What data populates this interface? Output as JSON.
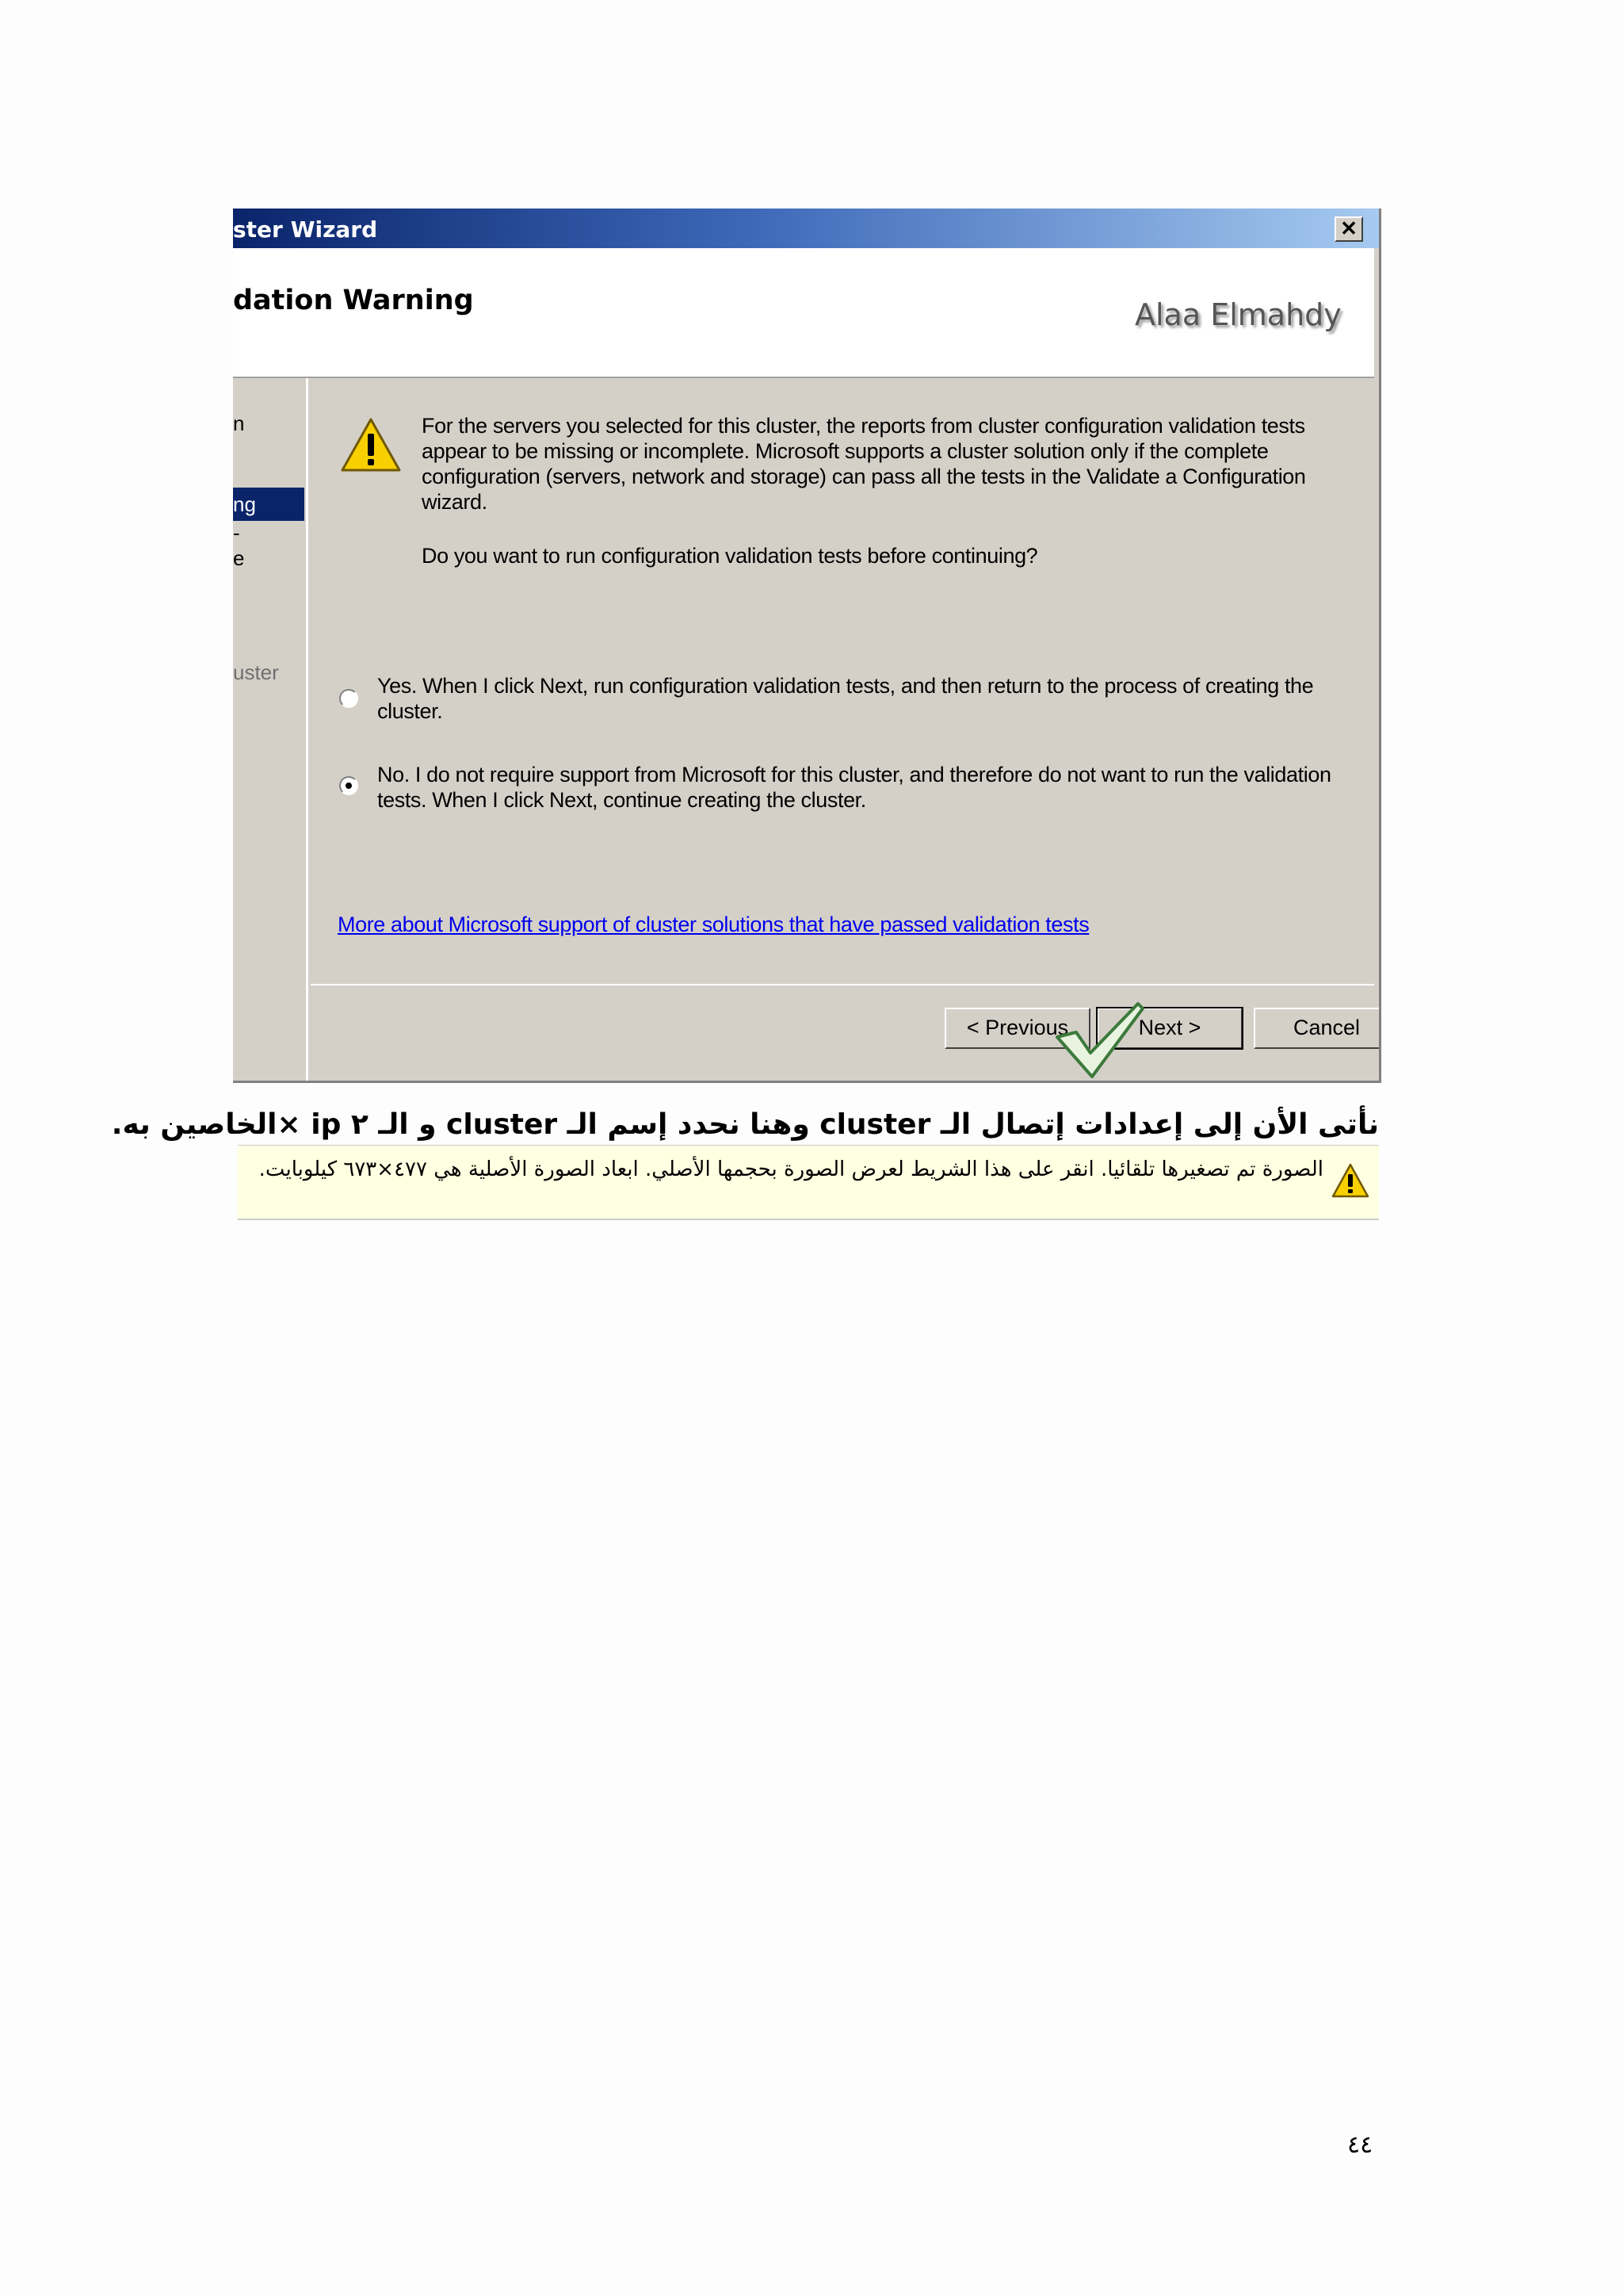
{
  "window": {
    "title": "ster Wizard",
    "close_symbol": "✕",
    "header_title": "dation Warning",
    "brand": "Alaa Elmahdy"
  },
  "nav": {
    "items": [
      "n",
      "ng",
      "-",
      "e",
      "uster"
    ],
    "selected_index": 1
  },
  "content": {
    "paragraph1": "For the servers you selected for this cluster, the reports from cluster configuration validation tests appear to be missing or incomplete.  Microsoft supports a cluster solution only if the complete configuration (servers, network and storage) can pass all the tests in the Validate a Configuration wizard.",
    "paragraph2": "Do you want to run configuration validation tests before continuing?",
    "option_yes": "Yes.  When I click Next, run configuration validation tests, and then return to the process of creating the cluster.",
    "option_no": "No.  I do not require support from Microsoft for this cluster, and therefore do not want to run the validation tests.  When I click Next, continue creating the cluster.",
    "selected_option": "no",
    "more_link": "More about Microsoft support of cluster solutions that have passed validation tests"
  },
  "buttons": {
    "previous": "< Previous",
    "next": "Next >",
    "cancel": "Cancel"
  },
  "caption": "نأتى الأن إلى إعدادات إتصال الـ cluster وهنا نحدد إسم الـ cluster و الـ ٢ ip ×الخاصين به.",
  "info_bar": {
    "text": "الصورة تم تصغيرها تلقائيا. انقر على هذا الشريط لعرض الصورة بحجمها الأصلي. ابعاد الصورة الأصلية هي ٤٧٧×٦٧٣ كيلوبايت."
  },
  "page_number": "٤٤",
  "colors": {
    "titlebar_start": "#0a246a",
    "titlebar_end": "#a6caf0",
    "dialog_bg": "#d4d0c8",
    "link": "#0000ee",
    "info_bg": "#ffffe1"
  }
}
